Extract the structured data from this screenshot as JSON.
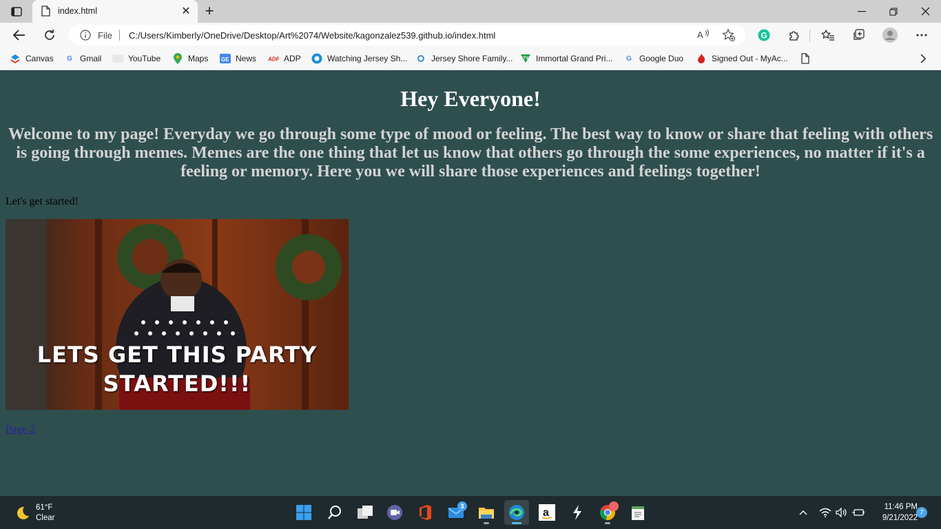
{
  "browser": {
    "tab_title": "index.html",
    "address_scheme": "File",
    "address_url": "C:/Users/Kimberly/OneDrive/Desktop/Art%2074/Website/kagonzalez539.github.io/index.html",
    "read_aloud_label": "A⁾"
  },
  "bookmarks": [
    {
      "label": "Canvas",
      "icon": "canvas-icon",
      "color": "#e2482d"
    },
    {
      "label": "Gmail",
      "icon": "google-icon",
      "color": "#4285f4"
    },
    {
      "label": "YouTube",
      "icon": "youtube-icon",
      "color": "#e0e0e0"
    },
    {
      "label": "Maps",
      "icon": "maps-pin-icon",
      "color": "#34a853"
    },
    {
      "label": "News",
      "icon": "google-news-icon",
      "color": "#4285f4"
    },
    {
      "label": "ADP",
      "icon": "adp-icon",
      "color": "#d0271d"
    },
    {
      "label": "Watching Jersey Sh...",
      "icon": "watch-icon",
      "color": "#1a8fd6"
    },
    {
      "label": "Jersey Shore Family...",
      "icon": "paramount-icon",
      "color": "#3c8fd8"
    },
    {
      "label": "Immortal Grand Pri...",
      "icon": "tv-icon",
      "color": "#1c9b3b"
    },
    {
      "label": "Google Duo",
      "icon": "google-icon",
      "color": "#4285f4"
    },
    {
      "label": "Signed Out - MyAc...",
      "icon": "flame-icon",
      "color": "#d61f1f"
    }
  ],
  "page": {
    "heading": "Hey Everyone!",
    "subheading": "Welcome to my page! Everyday we go through some type of mood or feeling. The best way to know or share that feeling with others is going through memes. Memes are the one thing that let us know that others go through the some experiences, no matter if it's a feeling or memory. Here you we will share those experiences and feelings together!",
    "intro": "Let's get started!",
    "gif_caption": "LETS GET THIS PARTY STARTED!!!",
    "link_label": "Page 2",
    "background_color": "#2f4f4f"
  },
  "taskbar": {
    "weather_temp": "61°F",
    "weather_cond": "Clear",
    "mail_badge": "3",
    "time": "11:46 PM",
    "date": "9/21/2022",
    "notification_count": "7"
  }
}
